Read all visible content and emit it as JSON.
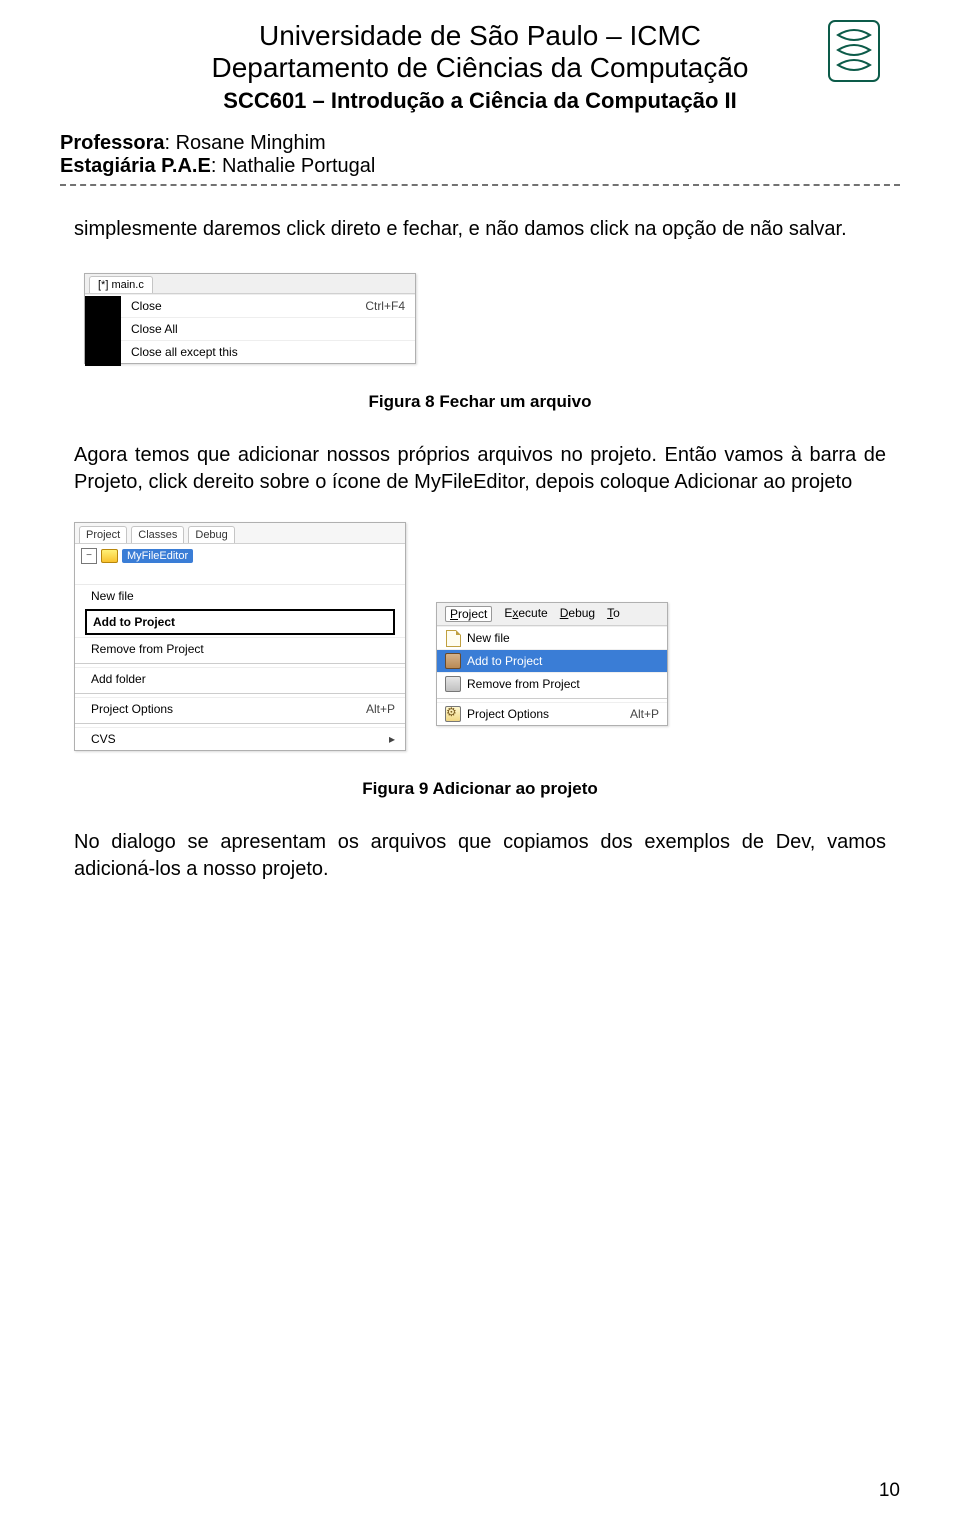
{
  "header": {
    "university": "Universidade de São Paulo – ICMC",
    "department": "Departamento de Ciências da Computação",
    "course": "SCC601 – Introdução a Ciência da Computação II",
    "professor_label": "Professora",
    "professor_name": ": Rosane Minghim",
    "estagiaria_label": "Estagiária P.A.E",
    "estagiaria_name": ": Nathalie Portugal"
  },
  "paragraphs": {
    "p1": "simplesmente daremos click direto e fechar, e não damos click na opção de não salvar.",
    "p2": "Agora temos que adicionar nossos próprios arquivos no projeto. Então vamos à barra de Projeto, click dereito sobre o ícone de MyFileEditor, depois coloque Adicionar ao projeto",
    "p3": "No dialogo se apresentam os arquivos que copiamos dos exemplos de Dev, vamos adicioná-los a nosso projeto."
  },
  "figures": {
    "f8_caption": "Figura 8 Fechar um arquivo",
    "f8_tab": "[*] main.c",
    "f8_menu": {
      "close": "Close",
      "close_accel": "Ctrl+F4",
      "close_all": "Close All",
      "close_except": "Close all except this"
    },
    "f9_caption": "Figura 9 Adicionar ao projeto",
    "f9a_tabs": {
      "project": "Project",
      "classes": "Classes",
      "debug": "Debug"
    },
    "f9a_tree_node": "MyFileEditor",
    "f9a_menu": {
      "new_file": "New file",
      "add": "Add to Project",
      "remove": "Remove from Project",
      "add_folder": "Add folder",
      "options": "Project Options",
      "options_accel": "Alt+P",
      "cvs": "CVS"
    },
    "f9b_menubar": {
      "project": "Project",
      "execute": "Execute",
      "debug": "Debug",
      "tools": "To"
    },
    "f9b_items": {
      "new_file": "New file",
      "add": "Add to Project",
      "remove": "Remove from Project",
      "options": "Project Options",
      "options_accel": "Alt+P"
    }
  },
  "page_number": "10"
}
